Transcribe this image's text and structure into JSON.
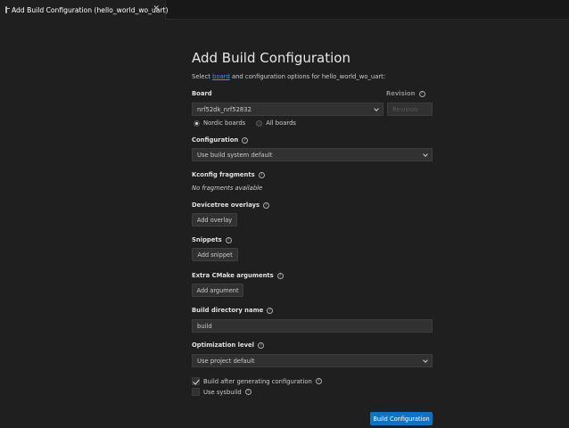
{
  "tab": {
    "title": "Add Build Configuration (hello_world_wo_uart)",
    "close": "✕"
  },
  "page": {
    "title": "Add Build Configuration",
    "subtitle_prefix": "Select ",
    "subtitle_link": "board",
    "subtitle_suffix": " and configuration options for hello_world_wo_uart:"
  },
  "board": {
    "label": "Board",
    "value": "nrf52dk_nrf52832",
    "revision_label": "Revision",
    "revision_placeholder": "Revision",
    "options": [
      "Nordic boards",
      "All boards"
    ],
    "selected": "Nordic boards"
  },
  "configuration": {
    "label": "Configuration",
    "value": "Use build system default"
  },
  "kconfig": {
    "label": "Kconfig fragments",
    "empty_text": "No fragments available"
  },
  "devicetree": {
    "label": "Devicetree overlays",
    "button": "Add overlay"
  },
  "snippets": {
    "label": "Snippets",
    "button": "Add snippet"
  },
  "cmake": {
    "label": "Extra CMake arguments",
    "button": "Add argument"
  },
  "build_dir": {
    "label": "Build directory name",
    "value": "build"
  },
  "optimization": {
    "label": "Optimization level",
    "value": "Use project default"
  },
  "options": {
    "build_after": {
      "label": "Build after generating configuration",
      "checked": true
    },
    "sysbuild": {
      "label": "Use sysbuild",
      "checked": false
    }
  },
  "actions": {
    "primary": "Build Configuration"
  },
  "help_glyph": "?"
}
